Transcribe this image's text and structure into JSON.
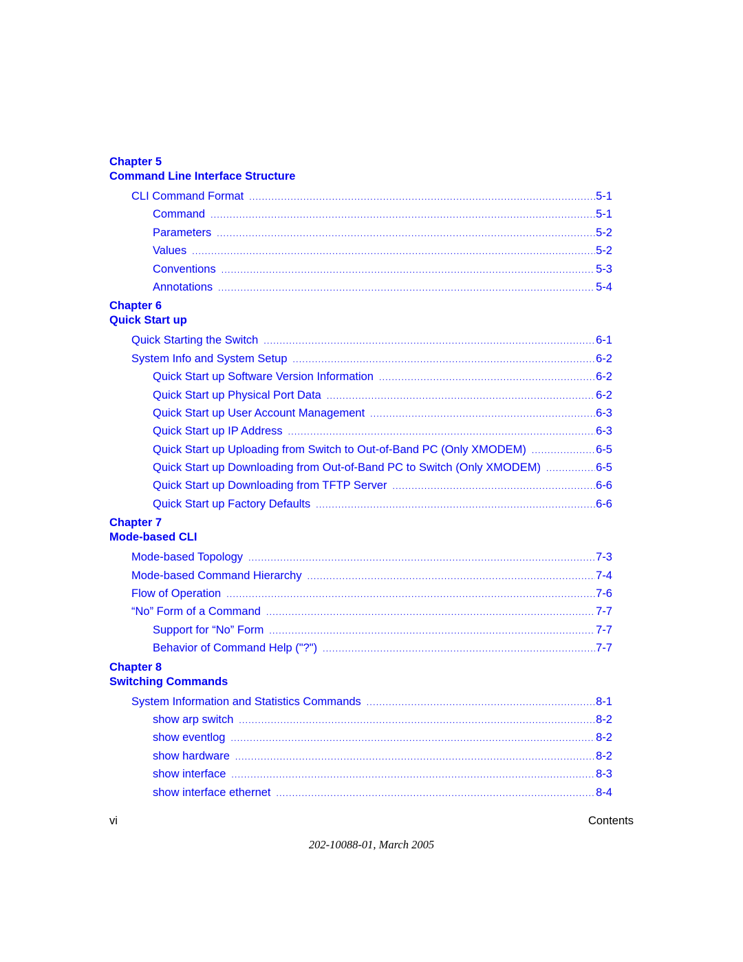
{
  "chapters": [
    {
      "number": "Chapter 5",
      "title": "Command Line Interface Structure",
      "entries": [
        {
          "label": "CLI Command Format",
          "page": "5-1",
          "level": 1
        },
        {
          "label": "Command",
          "page": "5-1",
          "level": 2
        },
        {
          "label": "Parameters",
          "page": "5-2",
          "level": 2
        },
        {
          "label": "Values",
          "page": "5-2",
          "level": 2
        },
        {
          "label": "Conventions",
          "page": "5-3",
          "level": 2
        },
        {
          "label": "Annotations",
          "page": "5-4",
          "level": 2
        }
      ]
    },
    {
      "number": "Chapter 6",
      "title": "Quick Start up",
      "entries": [
        {
          "label": "Quick Starting the Switch",
          "page": "6-1",
          "level": 1
        },
        {
          "label": "System Info and System Setup",
          "page": "6-2",
          "level": 1
        },
        {
          "label": "Quick Start up Software Version Information",
          "page": "6-2",
          "level": 2
        },
        {
          "label": "Quick Start up Physical Port Data",
          "page": "6-2",
          "level": 2
        },
        {
          "label": "Quick Start up User Account Management",
          "page": "6-3",
          "level": 2
        },
        {
          "label": "Quick Start up IP Address",
          "page": "6-3",
          "level": 2
        },
        {
          "label": "Quick Start up Uploading from Switch to Out-of-Band PC (Only XMODEM)",
          "page": "6-5",
          "level": 2
        },
        {
          "label": "Quick Start up Downloading from Out-of-Band PC to Switch (Only XMODEM)",
          "page": "6-5",
          "level": 2
        },
        {
          "label": "Quick Start up Downloading from TFTP Server",
          "page": "6-6",
          "level": 2
        },
        {
          "label": "Quick Start up Factory Defaults",
          "page": "6-6",
          "level": 2
        }
      ]
    },
    {
      "number": "Chapter 7",
      "title": "Mode-based CLI",
      "entries": [
        {
          "label": "Mode-based Topology",
          "page": "7-3",
          "level": 1
        },
        {
          "label": "Mode-based Command Hierarchy",
          "page": "7-4",
          "level": 1
        },
        {
          "label": "Flow of Operation",
          "page": "7-6",
          "level": 1
        },
        {
          "label": "“No” Form of a Command",
          "page": "7-7",
          "level": 1
        },
        {
          "label": "Support for “No” Form",
          "page": "7-7",
          "level": 2
        },
        {
          "label": "Behavior of Command Help (\"?\")",
          "page": "7-7",
          "level": 2
        }
      ]
    },
    {
      "number": "Chapter 8",
      "title": "Switching Commands",
      "entries": [
        {
          "label": "System Information and Statistics Commands",
          "page": "8-1",
          "level": 1
        },
        {
          "label": "show arp switch",
          "page": "8-2",
          "level": 2
        },
        {
          "label": "show eventlog",
          "page": "8-2",
          "level": 2
        },
        {
          "label": "show hardware",
          "page": "8-2",
          "level": 2
        },
        {
          "label": "show interface",
          "page": "8-3",
          "level": 2
        },
        {
          "label": "show interface ethernet",
          "page": "8-4",
          "level": 2
        }
      ]
    }
  ],
  "footer": {
    "page_number": "vi",
    "section": "Contents",
    "document_id": "202-10088-01, March 2005"
  },
  "colors": {
    "link": "#0000f0",
    "text": "#000000"
  }
}
